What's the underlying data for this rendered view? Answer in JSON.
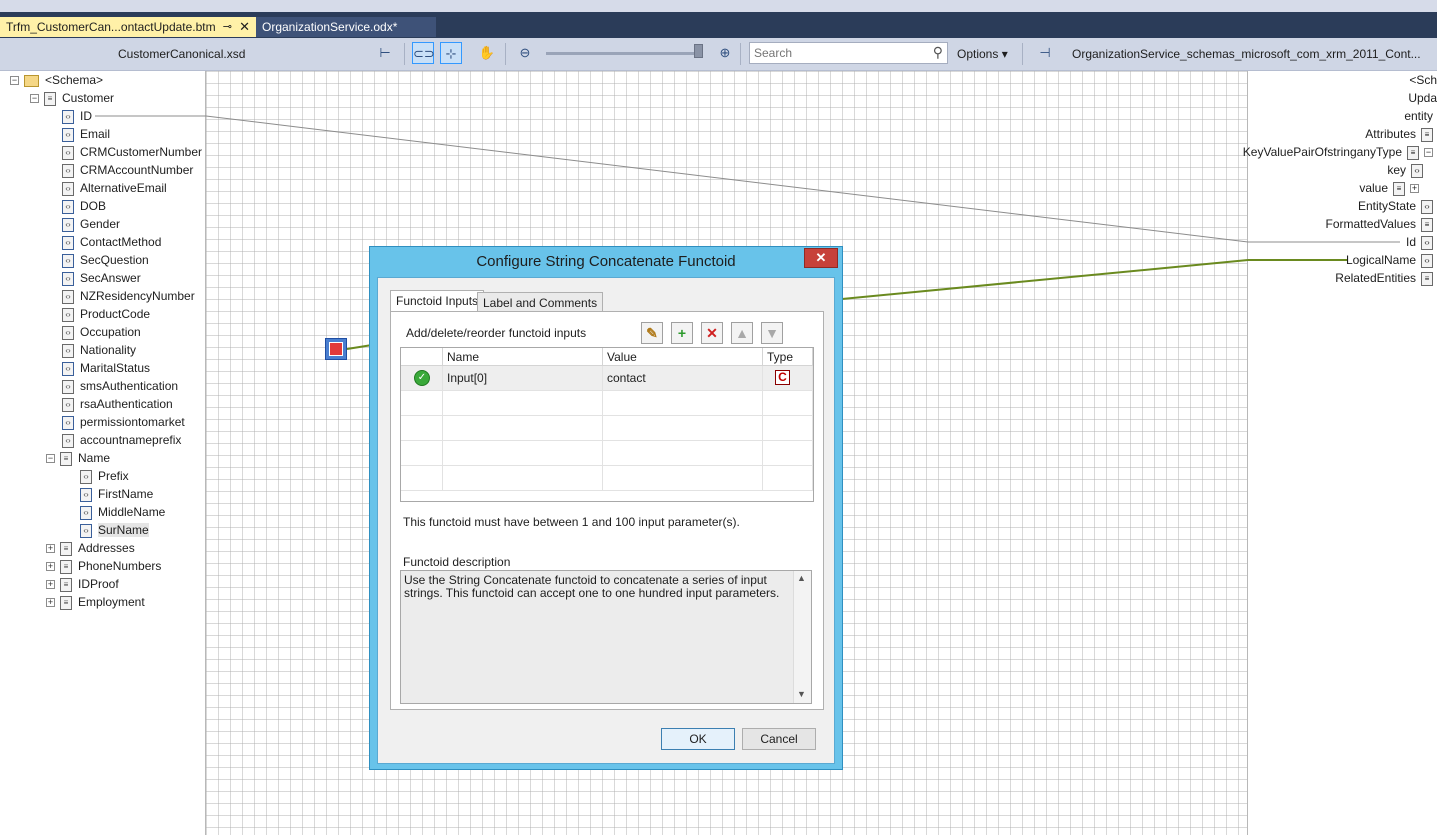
{
  "tabs": {
    "active": "Trfm_CustomerCan...ontactUpdate.btm",
    "inactive": "OrganizationService.odx*",
    "pin_glyph": "⊸",
    "close_glyph": "✕"
  },
  "toolbar": {
    "source_schema": "CustomerCanonical.xsd",
    "destination_schema": "OrganizationService_schemas_microsoft_com_xrm_2011_Cont...",
    "search_placeholder": "Search",
    "options_label": "Options ▾"
  },
  "source_tree": [
    {
      "label": "<Schema>",
      "icon": "folder-icon",
      "expander": "−"
    },
    {
      "label": "Customer",
      "icon": "record-icon",
      "expander": "−"
    },
    {
      "label": "ID",
      "icon": "field-link-icon"
    },
    {
      "label": "Email",
      "icon": "field-link-icon"
    },
    {
      "label": "CRMCustomerNumber",
      "icon": "field-icon"
    },
    {
      "label": "CRMAccountNumber",
      "icon": "field-icon"
    },
    {
      "label": "AlternativeEmail",
      "icon": "field-icon"
    },
    {
      "label": "DOB",
      "icon": "field-link-icon"
    },
    {
      "label": "Gender",
      "icon": "field-link-icon"
    },
    {
      "label": "ContactMethod",
      "icon": "field-link-icon"
    },
    {
      "label": "SecQuestion",
      "icon": "field-link-icon"
    },
    {
      "label": "SecAnswer",
      "icon": "field-link-icon"
    },
    {
      "label": "NZResidencyNumber",
      "icon": "field-icon"
    },
    {
      "label": "ProductCode",
      "icon": "field-icon"
    },
    {
      "label": "Occupation",
      "icon": "field-icon"
    },
    {
      "label": "Nationality",
      "icon": "field-icon"
    },
    {
      "label": "MaritalStatus",
      "icon": "field-link-icon"
    },
    {
      "label": "smsAuthentication",
      "icon": "field-icon"
    },
    {
      "label": "rsaAuthentication",
      "icon": "field-icon"
    },
    {
      "label": "permissiontomarket",
      "icon": "field-link-icon"
    },
    {
      "label": "accountnameprefix",
      "icon": "field-icon"
    },
    {
      "label": "Name",
      "icon": "record-icon",
      "expander": "−"
    },
    {
      "label": "Prefix",
      "icon": "field-icon"
    },
    {
      "label": "FirstName",
      "icon": "field-link-icon"
    },
    {
      "label": "MiddleName",
      "icon": "field-link-icon"
    },
    {
      "label": "SurName",
      "icon": "field-link-icon",
      "selected": true
    },
    {
      "label": "Addresses",
      "icon": "record-icon",
      "expander": "+"
    },
    {
      "label": "PhoneNumbers",
      "icon": "record-icon",
      "expander": "+"
    },
    {
      "label": "IDProof",
      "icon": "record-icon",
      "expander": "+"
    },
    {
      "label": "Employment",
      "icon": "record-icon",
      "expander": "+"
    }
  ],
  "dest_tree": [
    {
      "label": "<Sch"
    },
    {
      "label": "Upda"
    },
    {
      "label": "entity"
    },
    {
      "label": "Attributes",
      "icon": "record-icon"
    },
    {
      "label": "KeyValuePairOfstringanyType",
      "icon": "record-icon",
      "expander": "−"
    },
    {
      "label": "key",
      "icon": "field-icon"
    },
    {
      "label": "value",
      "icon": "record-icon",
      "expander": "+"
    },
    {
      "label": "EntityState",
      "icon": "field-icon"
    },
    {
      "label": "FormattedValues",
      "icon": "record-icon"
    },
    {
      "label": "Id",
      "icon": "field-link-icon"
    },
    {
      "label": "LogicalName",
      "icon": "field-link-icon"
    },
    {
      "label": "RelatedEntities",
      "icon": "record-icon"
    }
  ],
  "dialog": {
    "title": "Configure String Concatenate Functoid",
    "close_glyph": "✕",
    "tab_inputs": "Functoid Inputs",
    "tab_label": "Label and Comments",
    "instructions": "Add/delete/reorder functoid inputs",
    "columns": {
      "name": "Name",
      "value": "Value",
      "type": "Type"
    },
    "inputs": [
      {
        "name": "Input[0]",
        "value": "contact",
        "type_glyph": "C"
      }
    ],
    "constraint": "This functoid must have between 1 and 100 input parameter(s).",
    "description_label": "Functoid description",
    "description": "Use the String Concatenate functoid to concatenate a series of input strings. This functoid can accept one to one hundred input parameters.",
    "ok": "OK",
    "cancel": "Cancel"
  },
  "colors": {
    "accent_blue": "#68c3ea",
    "link_green": "#6a8a1f",
    "tab_active": "#fff1a8",
    "close_red": "#c7413a"
  }
}
